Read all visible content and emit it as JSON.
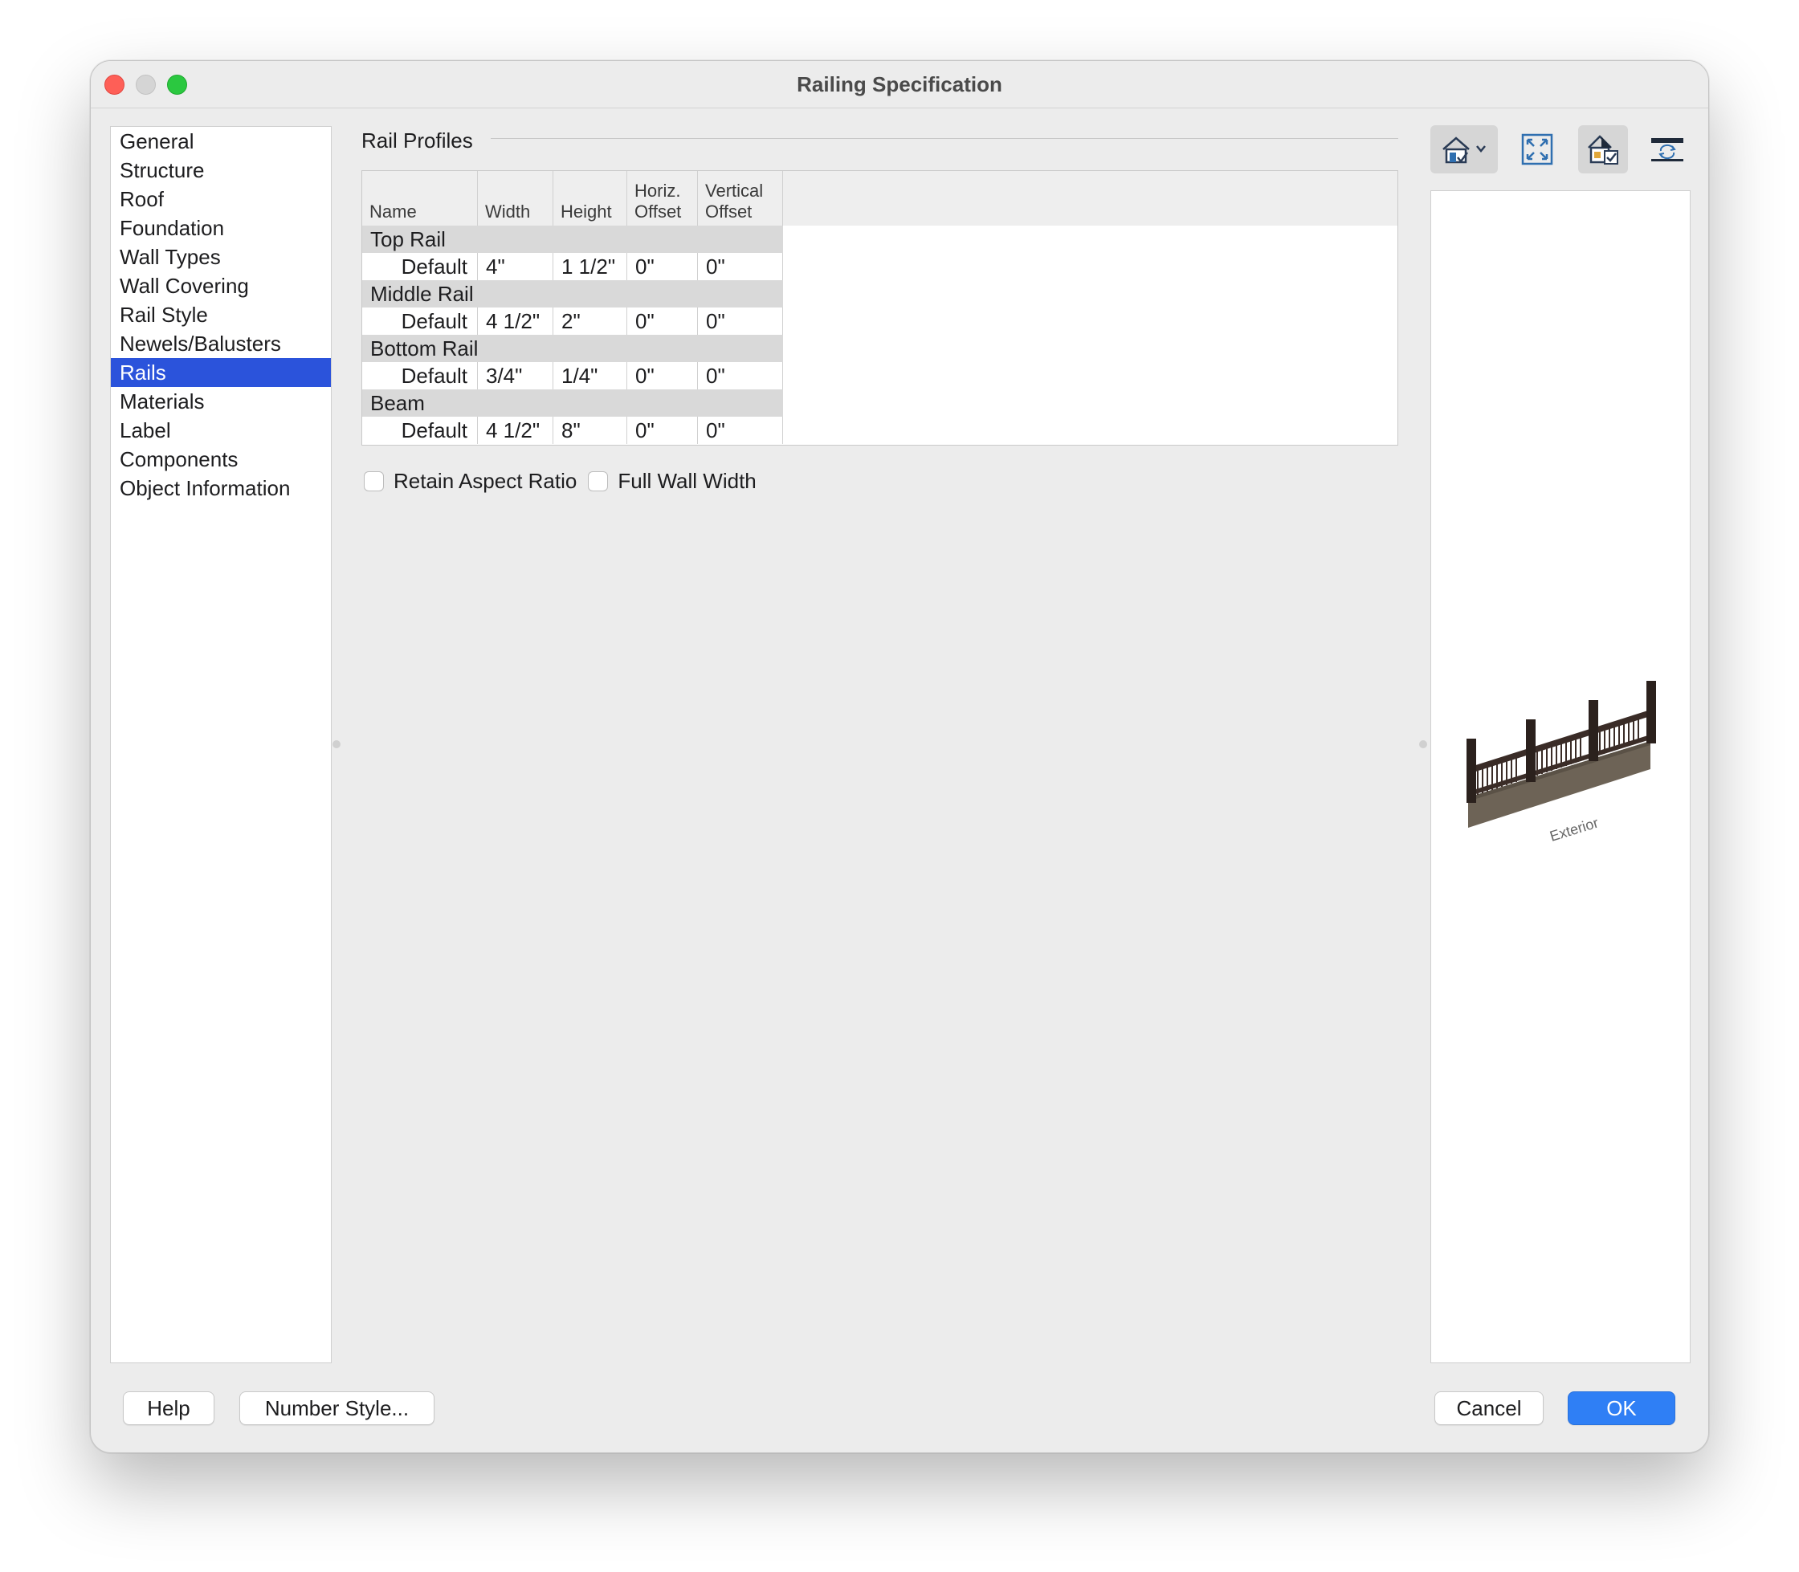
{
  "window": {
    "title": "Railing Specification"
  },
  "sidebar": {
    "items": [
      {
        "label": "General"
      },
      {
        "label": "Structure"
      },
      {
        "label": "Roof"
      },
      {
        "label": "Foundation"
      },
      {
        "label": "Wall Types"
      },
      {
        "label": "Wall Covering"
      },
      {
        "label": "Rail Style"
      },
      {
        "label": "Newels/Balusters"
      },
      {
        "label": "Rails",
        "selected": true
      },
      {
        "label": "Materials"
      },
      {
        "label": "Label"
      },
      {
        "label": "Components"
      },
      {
        "label": "Object Information"
      }
    ]
  },
  "rail_profiles": {
    "title": "Rail Profiles",
    "columns": {
      "name": "Name",
      "width": "Width",
      "height": "Height",
      "horiz_1": "Horiz.",
      "horiz_2": "Offset",
      "vert_1": "Vertical",
      "vert_2": "Offset"
    },
    "groups": [
      {
        "label": "Top Rail",
        "row": {
          "name": "Default",
          "width": "4\"",
          "height": "1 1/2\"",
          "horiz": "0\"",
          "vert": "0\""
        }
      },
      {
        "label": "Middle Rail",
        "row": {
          "name": "Default",
          "width": "4 1/2\"",
          "height": "2\"",
          "horiz": "0\"",
          "vert": "0\""
        }
      },
      {
        "label": "Bottom Rail",
        "row": {
          "name": "Default",
          "width": "3/4\"",
          "height": "1/4\"",
          "horiz": "0\"",
          "vert": "0\""
        }
      },
      {
        "label": "Beam",
        "row": {
          "name": "Default",
          "width": "4 1/2\"",
          "height": "8\"",
          "horiz": "0\"",
          "vert": "0\""
        }
      }
    ]
  },
  "options": {
    "retain_aspect_ratio": {
      "label": "Retain Aspect Ratio",
      "checked": false
    },
    "full_wall_width": {
      "label": "Full Wall Width",
      "checked": false
    }
  },
  "preview": {
    "label": "Exterior",
    "toolbar_icons": [
      "3d-view-dropdown-icon",
      "fill-window-icon",
      "show-preview-icon",
      "refresh-preview-icon"
    ]
  },
  "footer": {
    "help": "Help",
    "number_style": "Number Style...",
    "cancel": "Cancel",
    "ok": "OK"
  },
  "colors": {
    "accent": "#2b53db",
    "primary_button": "#2f7ff5",
    "rail_dark": "#3a2c27",
    "deck": "#6d6356"
  }
}
